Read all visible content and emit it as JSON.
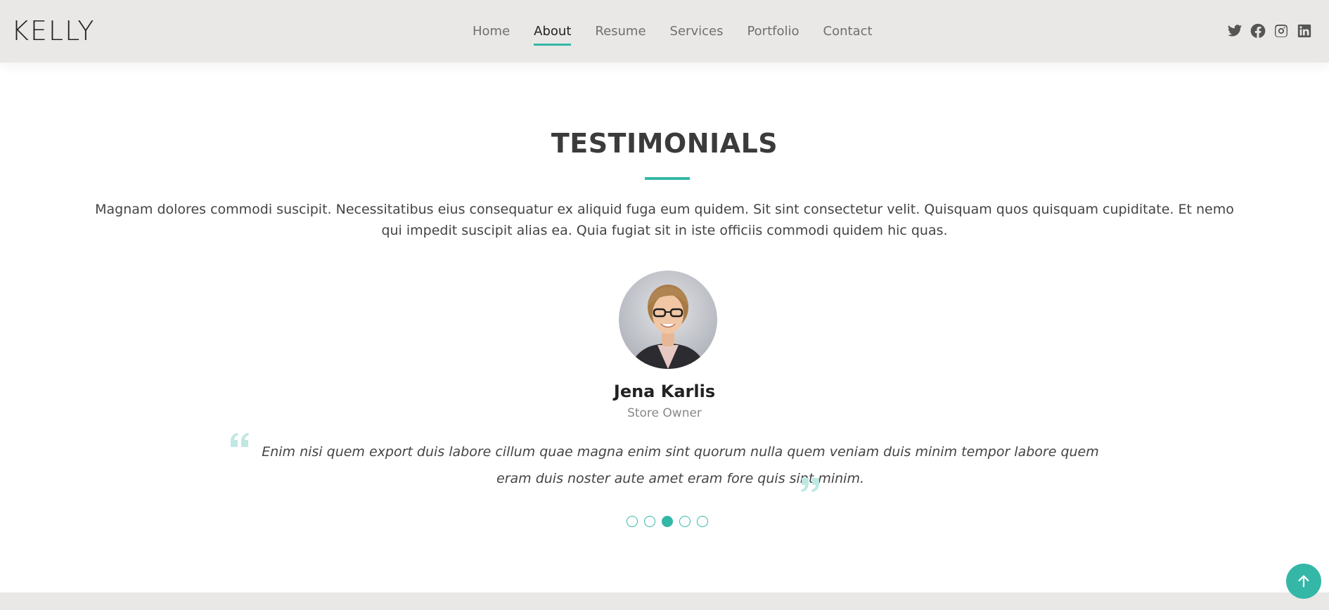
{
  "header": {
    "logo": "KELLY",
    "nav": [
      {
        "label": "Home"
      },
      {
        "label": "About"
      },
      {
        "label": "Resume"
      },
      {
        "label": "Services"
      },
      {
        "label": "Portfolio"
      },
      {
        "label": "Contact"
      }
    ],
    "active_nav": "About",
    "social_icons": [
      "twitter-icon",
      "facebook-icon",
      "instagram-icon",
      "linkedin-icon"
    ]
  },
  "section": {
    "title": "TESTIMONIALS",
    "intro": "Magnam dolores commodi suscipit. Necessitatibus eius consequatur ex aliquid fuga eum quidem. Sit sint consectetur velit. Quisquam quos quisquam cupiditate. Et nemo qui impedit suscipit alias ea. Quia fugiat sit in iste officiis commodi quidem hic quas."
  },
  "testimonial": {
    "name": "Jena Karlis",
    "role": "Store Owner",
    "quote": "Enim nisi quem export duis labore cillum quae magna enim sint quorum nulla quem veniam duis minim tempor labore quem eram duis noster aute amet eram fore quis sint minim."
  },
  "carousel": {
    "total_slides": 5,
    "active_slide": 3
  },
  "colors": {
    "accent": "#34b7a7",
    "header_bg": "#e9e8e6",
    "quote_icon": "#bfe8e2",
    "title": "#3b3b3b"
  }
}
